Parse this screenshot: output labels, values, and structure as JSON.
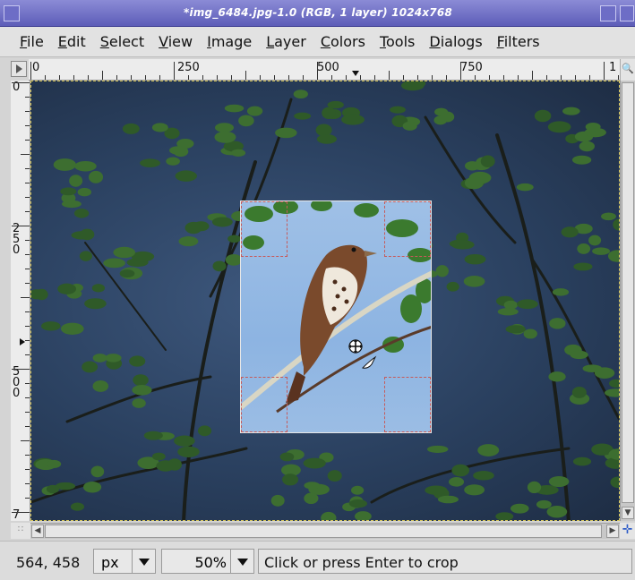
{
  "window": {
    "title": "*img_6484.jpg-1.0 (RGB, 1 layer) 1024x768"
  },
  "menubar": {
    "items": [
      "File",
      "Edit",
      "Select",
      "View",
      "Image",
      "Layer",
      "Colors",
      "Tools",
      "Dialogs",
      "Filters"
    ]
  },
  "rulers": {
    "horizontal_labels": [
      "0",
      "250",
      "500",
      "750",
      "1"
    ],
    "vertical_labels": [
      "0",
      "250",
      "500",
      "7"
    ]
  },
  "statusbar": {
    "coordinates": "564, 458",
    "unit": "px",
    "zoom": "50%",
    "message": "Click or press Enter to crop"
  },
  "icons": {
    "move_cursor": "move-cursor-icon",
    "crop_knife": "crop-knife-icon",
    "navigate": "navigate-icon"
  },
  "colors": {
    "titlebar": "#6b6bc4",
    "sky": "#8db4e2",
    "foliage": "#2f5a28"
  }
}
